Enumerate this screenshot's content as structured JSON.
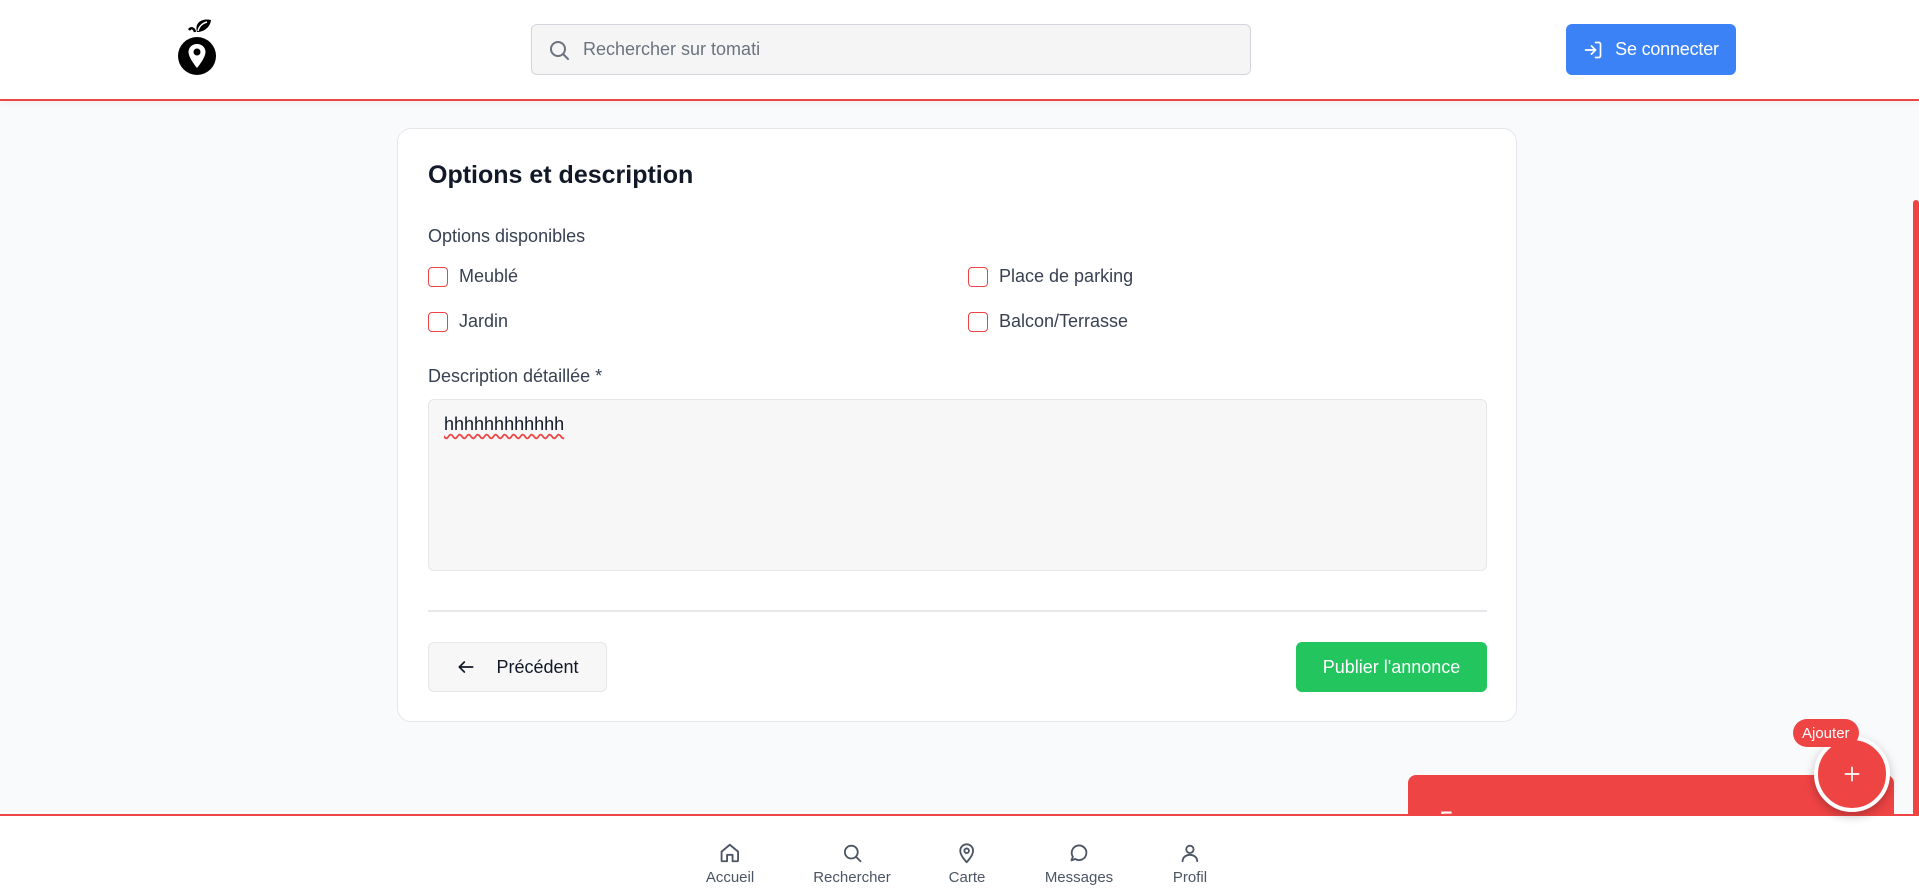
{
  "header": {
    "search_placeholder": "Rechercher sur tomati",
    "login_label": "Se connecter",
    "logo_icon": "apple-location-pin-icon",
    "search_icon": "search-icon",
    "login_icon": "login-arrow-icon"
  },
  "form": {
    "title": "Options et description",
    "options_label": "Options disponibles",
    "options": [
      {
        "label": "Meublé",
        "checked": false
      },
      {
        "label": "Place de parking",
        "checked": false
      },
      {
        "label": "Jardin",
        "checked": false
      },
      {
        "label": "Balcon/Terrasse",
        "checked": false
      }
    ],
    "description_label": "Description détaillée *",
    "description_value": "hhhhhhhhhhhh",
    "prev_label": "Précédent",
    "publish_label": "Publier l'annonce"
  },
  "toast": {
    "title": "Erreur"
  },
  "fab": {
    "badge": "Ajouter",
    "icon": "plus-icon"
  },
  "nav": {
    "items": [
      {
        "label": "Accueil",
        "icon": "home-icon"
      },
      {
        "label": "Rechercher",
        "icon": "search-icon"
      },
      {
        "label": "Carte",
        "icon": "map-pin-icon"
      },
      {
        "label": "Messages",
        "icon": "chat-bubble-icon"
      },
      {
        "label": "Profil",
        "icon": "user-icon"
      }
    ]
  },
  "colors": {
    "accent_red": "#ef4444",
    "primary_blue": "#3b82f6",
    "success_green": "#22c55e"
  }
}
